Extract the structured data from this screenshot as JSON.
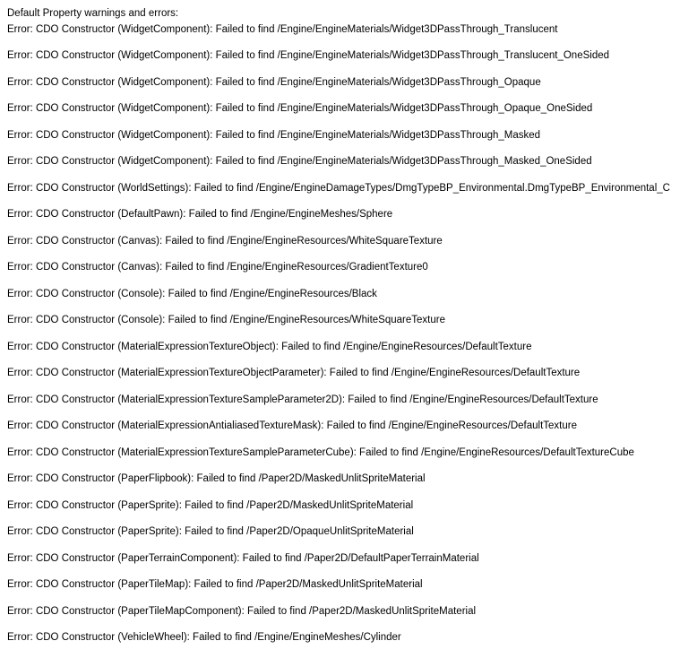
{
  "header": "Default Property warnings and errors:",
  "error_prefix": "Error: CDO Constructor ",
  "failed_text": ": Failed to find ",
  "errors": [
    {
      "cls": "WidgetComponent",
      "path": "/Engine/EngineMaterials/Widget3DPassThrough_Translucent"
    },
    {
      "cls": "WidgetComponent",
      "path": "/Engine/EngineMaterials/Widget3DPassThrough_Translucent_OneSided"
    },
    {
      "cls": "WidgetComponent",
      "path": "/Engine/EngineMaterials/Widget3DPassThrough_Opaque"
    },
    {
      "cls": "WidgetComponent",
      "path": "/Engine/EngineMaterials/Widget3DPassThrough_Opaque_OneSided"
    },
    {
      "cls": "WidgetComponent",
      "path": "/Engine/EngineMaterials/Widget3DPassThrough_Masked"
    },
    {
      "cls": "WidgetComponent",
      "path": "/Engine/EngineMaterials/Widget3DPassThrough_Masked_OneSided"
    },
    {
      "cls": "WorldSettings",
      "path": "/Engine/EngineDamageTypes/DmgTypeBP_Environmental.DmgTypeBP_Environmental_C"
    },
    {
      "cls": "DefaultPawn",
      "path": "/Engine/EngineMeshes/Sphere"
    },
    {
      "cls": "Canvas",
      "path": "/Engine/EngineResources/WhiteSquareTexture"
    },
    {
      "cls": "Canvas",
      "path": "/Engine/EngineResources/GradientTexture0"
    },
    {
      "cls": "Console",
      "path": "/Engine/EngineResources/Black"
    },
    {
      "cls": "Console",
      "path": "/Engine/EngineResources/WhiteSquareTexture"
    },
    {
      "cls": "MaterialExpressionTextureObject",
      "path": "/Engine/EngineResources/DefaultTexture"
    },
    {
      "cls": "MaterialExpressionTextureObjectParameter",
      "path": "/Engine/EngineResources/DefaultTexture"
    },
    {
      "cls": "MaterialExpressionTextureSampleParameter2D",
      "path": "/Engine/EngineResources/DefaultTexture"
    },
    {
      "cls": "MaterialExpressionAntialiasedTextureMask",
      "path": "/Engine/EngineResources/DefaultTexture"
    },
    {
      "cls": "MaterialExpressionTextureSampleParameterCube",
      "path": "/Engine/EngineResources/DefaultTextureCube"
    },
    {
      "cls": "PaperFlipbook",
      "path": "/Paper2D/MaskedUnlitSpriteMaterial"
    },
    {
      "cls": "PaperSprite",
      "path": "/Paper2D/MaskedUnlitSpriteMaterial"
    },
    {
      "cls": "PaperSprite",
      "path": "/Paper2D/OpaqueUnlitSpriteMaterial"
    },
    {
      "cls": "PaperTerrainComponent",
      "path": "/Paper2D/DefaultPaperTerrainMaterial"
    },
    {
      "cls": "PaperTileMap",
      "path": "/Paper2D/MaskedUnlitSpriteMaterial"
    },
    {
      "cls": "PaperTileMapComponent",
      "path": "/Paper2D/MaskedUnlitSpriteMaterial"
    },
    {
      "cls": "VehicleWheel",
      "path": "/Engine/EngineMeshes/Cylinder"
    }
  ]
}
